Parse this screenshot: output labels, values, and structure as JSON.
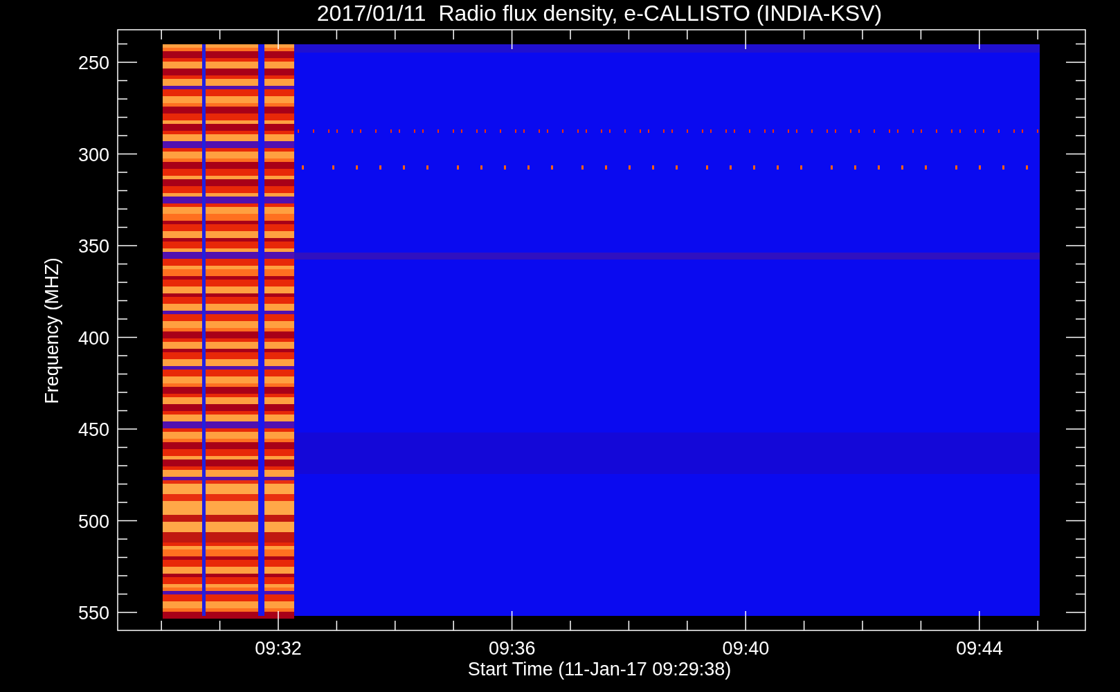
{
  "title": "2017/01/11  Radio flux density, e-CALLISTO (INDIA-KSV)",
  "plot": {
    "ylabel": "Frequency (MHZ)",
    "xlabel": "Start Time (11-Jan-17 09:29:38)",
    "yticks": [
      "250",
      "300",
      "350",
      "400",
      "450",
      "500",
      "550"
    ],
    "xticks": [
      "09:32",
      "09:36",
      "09:40",
      "09:44"
    ]
  }
}
